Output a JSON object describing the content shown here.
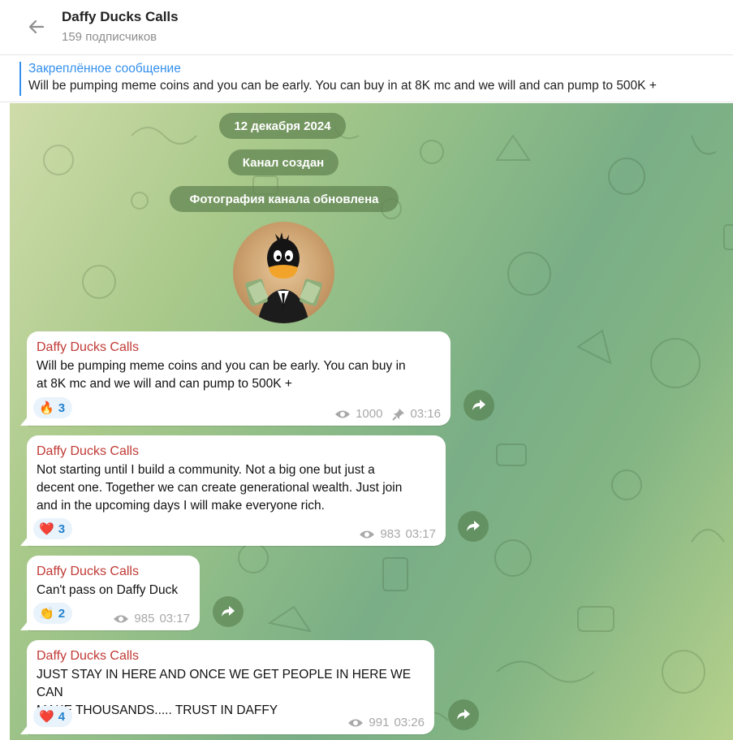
{
  "header": {
    "title": "Daffy Ducks Calls",
    "subtitle": "159 подписчиков"
  },
  "pinned": {
    "title": "Закреплённое сообщение",
    "text": "Will be pumping meme coins and you can be early. You can buy in at 8K mc and we will and can pump to 500K +"
  },
  "service": {
    "date": "12 декабря 2024",
    "created": "Канал создан",
    "photo_updated": "Фотография канала обновлена"
  },
  "messages": [
    {
      "author": "Daffy Ducks Calls",
      "lines": [
        "Will be pumping meme coins and you can be early. You can buy in",
        "at 8K mc and we will and can pump to 500K +"
      ],
      "reaction_emoji": "🔥",
      "reaction_count": "3",
      "views": "1000",
      "time": "03:16",
      "pinned": true
    },
    {
      "author": "Daffy Ducks Calls",
      "lines": [
        "Not starting until I build a community. Not a big one but just a",
        "decent one. Together we can create generational wealth. Just join",
        "and in the upcoming days I will make everyone rich."
      ],
      "reaction_emoji": "❤️",
      "reaction_count": "3",
      "views": "983",
      "time": "03:17"
    },
    {
      "author": "Daffy Ducks Calls",
      "lines": [
        "Can't pass on Daffy Duck"
      ],
      "reaction_emoji": "👏",
      "reaction_count": "2",
      "views": "985",
      "time": "03:17"
    },
    {
      "author": "Daffy Ducks Calls",
      "lines": [
        "JUST STAY IN HERE AND ONCE WE GET PEOPLE IN HERE WE CAN",
        "MAKE THOUSANDS..... TRUST IN DAFFY"
      ],
      "reaction_emoji": "❤️",
      "reaction_count": "4",
      "views": "991",
      "time": "03:26"
    }
  ],
  "colors": {
    "accent": "#3390ec",
    "author": "#c03a35",
    "reaction_text": "#2481cc"
  },
  "icons": [
    "back-arrow-icon",
    "eye-icon",
    "pin-icon",
    "share-icon"
  ]
}
